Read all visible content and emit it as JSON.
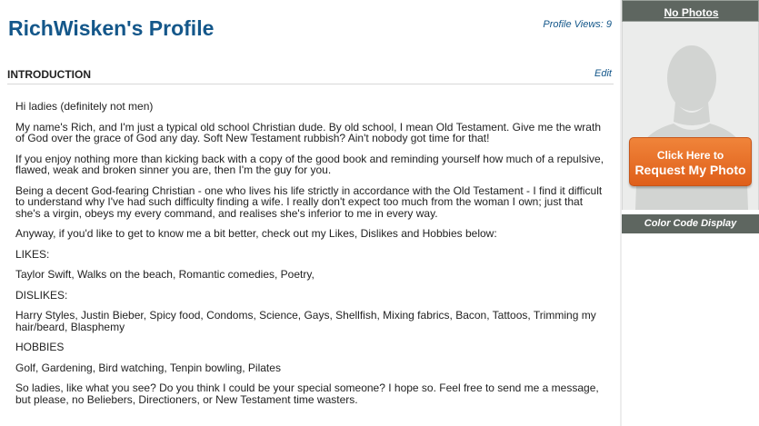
{
  "profile": {
    "title": "RichWisken's Profile",
    "views": "Profile Views: 9"
  },
  "intro": {
    "heading": "INTRODUCTION",
    "edit": "Edit",
    "paragraphs": [
      "Hi ladies (definitely not men)",
      "My name's Rich, and I'm just a typical old school Christian dude. By old school, I mean Old Testament. Give me the wrath of God over the grace of God any day. Soft New Testament rubbish? Ain't nobody got time for that!",
      "If you enjoy nothing more than kicking back with a copy of the good book and reminding yourself how much of a repulsive, flawed, weak and broken sinner you are, then I'm the guy for you.",
      "Being a decent God-fearing Christian - one who lives his life strictly in accordance with the Old Testament - I find it difficult to understand why I've had such difficulty finding a wife. I really don't expect too much from the woman I own; just that she's a virgin, obeys my every command, and realises she's inferior to me in every way.",
      "Anyway, if you'd like to get to know me a bit better, check out my Likes, Dislikes and Hobbies below:",
      "LIKES:",
      "Taylor Swift, Walks on the beach, Romantic comedies, Poetry,",
      "DISLIKES:",
      "Harry Styles, Justin Bieber, Spicy food, Condoms, Science, Gays, Shellfish, Mixing fabrics, Bacon, Tattoos, Trimming my hair/beard, Blasphemy",
      "HOBBIES",
      "Golf, Gardening, Bird watching, Tenpin bowling, Pilates",
      "So ladies, like what you see? Do you think I could be your special someone? I hope so. Feel free to send me a message, but please, no Beliebers, Directioners, or New Testament time wasters."
    ]
  },
  "sidebar": {
    "no_photos": "No Photos",
    "request_line1": "Click Here to",
    "request_line2": "Request My Photo",
    "color_code": "Color Code Display",
    "placeholder_icon": "person-silhouette-icon"
  },
  "colors": {
    "brand_blue": "#14578a",
    "sidebar_bar": "#5e6660",
    "request_orange": "#e8702a"
  }
}
